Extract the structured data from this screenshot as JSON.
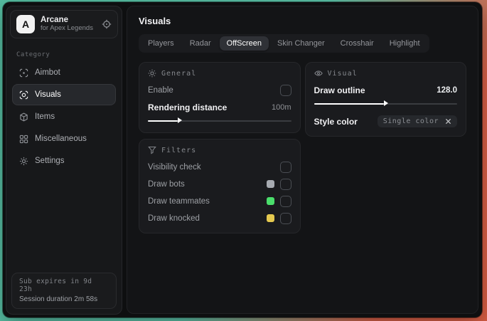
{
  "brand": {
    "logo_letter": "A",
    "title": "Arcane",
    "subtitle": "for Apex Legends"
  },
  "sidebar": {
    "category_label": "Category",
    "items": [
      {
        "label": "Aimbot",
        "active": false
      },
      {
        "label": "Visuals",
        "active": true
      },
      {
        "label": "Items",
        "active": false
      },
      {
        "label": "Miscellaneous",
        "active": false
      },
      {
        "label": "Settings",
        "active": false
      }
    ],
    "footer": {
      "expiry": "Sub expires in 9d 23h",
      "session": "Session duration 2m 58s"
    }
  },
  "main": {
    "title": "Visuals",
    "tabs": [
      {
        "label": "Players",
        "active": false
      },
      {
        "label": "Radar",
        "active": false
      },
      {
        "label": "OffScreen",
        "active": true
      },
      {
        "label": "Skin Changer",
        "active": false
      },
      {
        "label": "Crosshair",
        "active": false
      },
      {
        "label": "Highlight",
        "active": false
      }
    ]
  },
  "cards": {
    "general": {
      "title": "General",
      "enable_label": "Enable",
      "enable_checked": false,
      "distance_label": "Rendering distance",
      "distance_value": "100m",
      "distance_percent": 21
    },
    "filters": {
      "title": "Filters",
      "rows": [
        {
          "label": "Visibility check",
          "checked": false
        },
        {
          "label": "Draw bots",
          "swatch": "#a7abb1",
          "checked": false
        },
        {
          "label": "Draw teammates",
          "swatch": "#4ade6b",
          "checked": false
        },
        {
          "label": "Draw knocked",
          "swatch": "#e5c94f",
          "checked": false
        }
      ]
    },
    "visual": {
      "title": "Visual",
      "outline_label": "Draw outline",
      "outline_value": "128.0",
      "outline_percent": 49,
      "style_label": "Style color",
      "style_value": "Single color"
    }
  }
}
